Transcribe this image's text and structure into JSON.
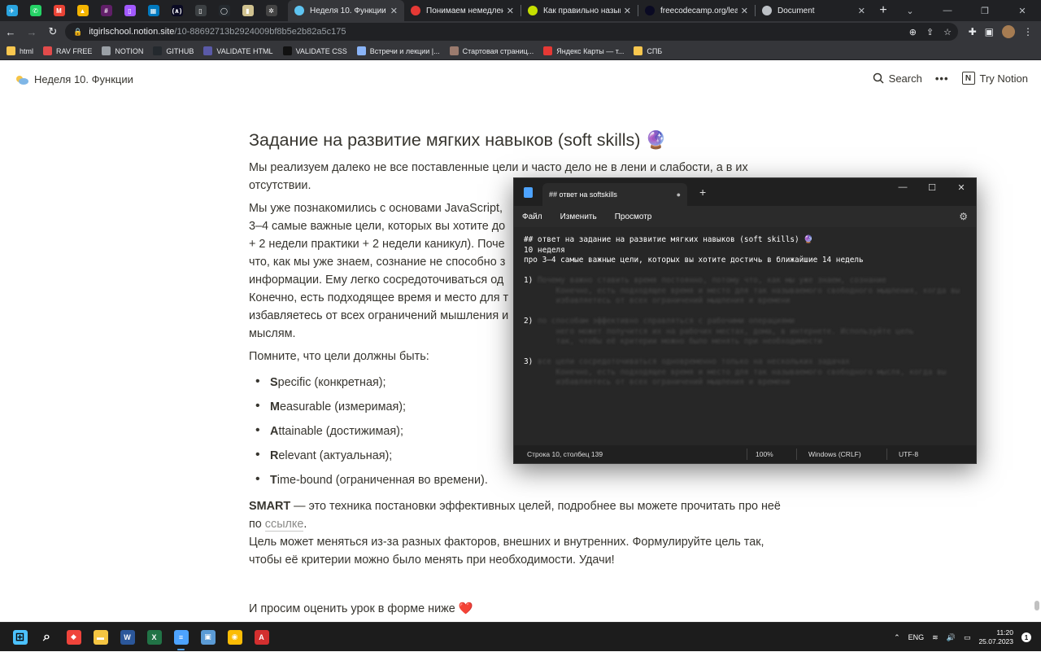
{
  "browser": {
    "pinned_tabs": [
      {
        "name": "telegram",
        "color": "#2aa4df",
        "glyph": "✈"
      },
      {
        "name": "whatsapp",
        "color": "#25d366",
        "glyph": "✆"
      },
      {
        "name": "gmail",
        "color": "#ea4335",
        "glyph": "M"
      },
      {
        "name": "drive",
        "color": "#f4b400",
        "glyph": "▲"
      },
      {
        "name": "slack",
        "color": "#611f69",
        "glyph": "#"
      },
      {
        "name": "figma",
        "color": "#a259ff",
        "glyph": "▯"
      },
      {
        "name": "trello",
        "color": "#0079bf",
        "glyph": "▦"
      },
      {
        "name": "freecodecamp",
        "color": "#0a0a23",
        "glyph": "(∧)"
      },
      {
        "name": "terminal",
        "color": "#3c4043",
        "glyph": "▯"
      },
      {
        "name": "github",
        "color": "#24292e",
        "glyph": "◯"
      },
      {
        "name": "bookmark",
        "color": "#d0c28f",
        "glyph": "▮"
      },
      {
        "name": "openai",
        "color": "#444",
        "glyph": "✲"
      }
    ],
    "tabs": [
      {
        "title": "Неделя 10. Функции",
        "active": true,
        "favicon": "#5ec4f1"
      },
      {
        "title": "Понимаем немедленно",
        "active": false,
        "favicon": "#e53935"
      },
      {
        "title": "Как правильно называ",
        "active": false,
        "favicon": "#c6e000"
      },
      {
        "title": "freecodecamp.org/learn",
        "active": false,
        "favicon": "#0a0a23"
      },
      {
        "title": "Document",
        "active": false,
        "favicon": "#bdc1c6"
      }
    ],
    "url_host": "itgirlschool.notion.site",
    "url_path": "/10-88692713b2924009bf8b5e2b82a5c175",
    "bookmarks": [
      {
        "label": "html",
        "color": "#f9c74f"
      },
      {
        "label": "RAV FREE",
        "color": "#e24b4b"
      },
      {
        "label": "NOTION",
        "color": "#9aa0a6"
      },
      {
        "label": "GITHUB",
        "color": "#24292e"
      },
      {
        "label": "VALIDATE HTML",
        "color": "#5a5aa8"
      },
      {
        "label": "VALIDATE CSS",
        "color": "#111"
      },
      {
        "label": "Встречи и лекции |...",
        "color": "#8ab4f8"
      },
      {
        "label": "Стартовая страниц...",
        "color": "#9b7b6e"
      },
      {
        "label": "Яндекс Карты — т...",
        "color": "#e53935"
      },
      {
        "label": "СПБ",
        "color": "#f9c74f"
      }
    ]
  },
  "notion": {
    "page_title": "Неделя 10. Функции",
    "search_label": "Search",
    "more_label": "•••",
    "try_label": "Try Notion"
  },
  "page": {
    "heading": "Задание на развитие мягких навыков (soft skills) 🔮",
    "p1": "Мы реализуем далеко не все поставленные цели и часто дело не в лени и слабости, а в их отсутствии.",
    "p2_lines": [
      "Мы уже познакомились с основами JavaScript,",
      "3–4 самые важные цели, которых вы хотите до",
      "+ 2 недели практики + 2 недели каникул). Поче",
      "что, как мы уже знаем, сознание не способно з",
      "информации. Ему легко сосредоточиваться од",
      "Конечно, есть подходящее время и место для т",
      "избавляетесь от всех ограничений мышления и",
      "мыслям."
    ],
    "p3": "Помните, что цели должны быть:",
    "smart": [
      {
        "letter": "S",
        "rest": "pecific (конкретная);"
      },
      {
        "letter": "M",
        "rest": "easurable (измеримая);"
      },
      {
        "letter": "A",
        "rest": "ttainable (достижимая);"
      },
      {
        "letter": "R",
        "rest": "elevant (актуальная);"
      },
      {
        "letter": "T",
        "rest": "ime-bound (ограниченная во времени)."
      }
    ],
    "p4_strong": "SMART",
    "p4_rest": " — это техника постановки эффективных целей, подробнее вы можете прочитать про неё по ",
    "p4_link": "ссылке",
    "p4_end": ".",
    "p5": "Цель может меняться из-за разных факторов, внешних и внутренних. Формулируйте цель так, чтобы её критерии можно было менять при необходимости. Удачи!",
    "p6": "И просим оценить урок в форме ниже ❤️"
  },
  "notepad": {
    "tab_title": "## ответ на softskills",
    "menu": [
      "Файл",
      "Изменить",
      "Просмотр"
    ],
    "lines": [
      "## ответ на задание на развитие мягких навыков (soft skills) 🔮",
      "10 неделя",
      "про 3–4 самые важные цели, которых вы хотите достичь в ближайшие 14 недель"
    ],
    "items": [
      {
        "num": "1)",
        "blur": [
          "Почему важно ставить время постоянно, потому что, как мы уже знаем, сознание",
          "       Конечно, есть подходящее время и место для так называемого свободного мышления, когда вы",
          "       избавляетесь от всех ограничений мышления и времени"
        ]
      },
      {
        "num": "2)",
        "blur": [
          "по способам эффективно справляться с рабочими операциями",
          "       него может получится их на рабочих местах, дома, в интернете. Используйте цель",
          "       так, чтобы её критерии можно было менять при необходимости"
        ]
      },
      {
        "num": "3)",
        "blur": [
          "все цели сосредоточиваться одновременно только на нескольких задачах",
          "       Конечно, есть подходящее время и место для так называемого свободного мысля, когда вы",
          "       избавляетесь от всех ограничений мышления и времени"
        ]
      }
    ],
    "status": {
      "position": "Строка 10, столбец 139",
      "zoom": "100%",
      "eol": "Windows (CRLF)",
      "encoding": "UTF-8"
    }
  },
  "taskbar": {
    "apps": [
      {
        "name": "start",
        "color": "#4cc2ff",
        "glyph": "⊞"
      },
      {
        "name": "search",
        "color": "transparent",
        "glyph": "⌕"
      },
      {
        "name": "anydesk",
        "color": "#ef443b",
        "glyph": "◆"
      },
      {
        "name": "explorer",
        "color": "#f5c542",
        "glyph": "▬"
      },
      {
        "name": "word",
        "color": "#2b579a",
        "glyph": "W"
      },
      {
        "name": "excel",
        "color": "#217346",
        "glyph": "X"
      },
      {
        "name": "notepad",
        "color": "#4da3ff",
        "glyph": "≡"
      },
      {
        "name": "photos",
        "color": "#5b9bd5",
        "glyph": "▣"
      },
      {
        "name": "chrome",
        "color": "#fbbc05",
        "glyph": "◉"
      },
      {
        "name": "acrobat",
        "color": "#d32f2f",
        "glyph": "A"
      }
    ],
    "lang": "ENG",
    "time": "11:20",
    "date": "25.07.2023",
    "notif": "1"
  }
}
